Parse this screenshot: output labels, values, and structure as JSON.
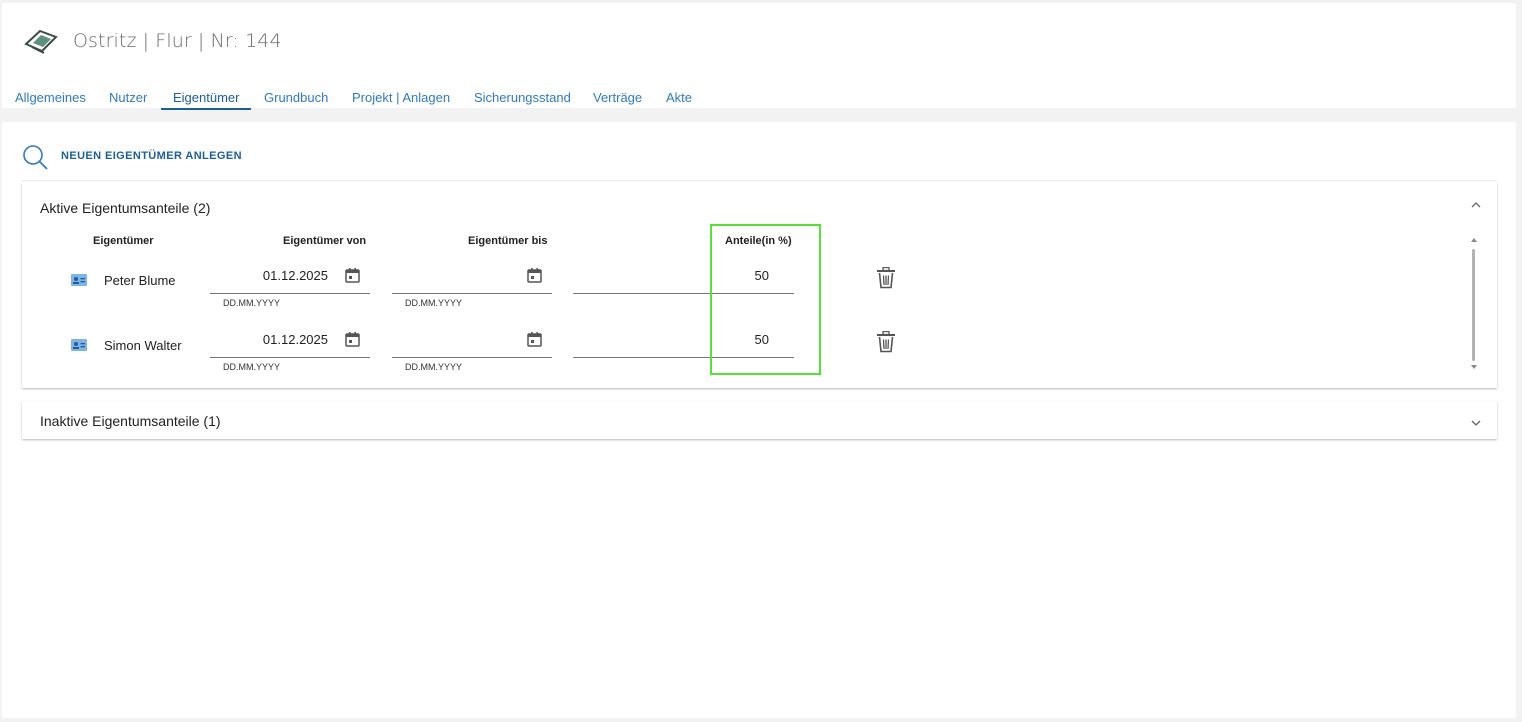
{
  "header": {
    "title": "Ostritz | Flur | Nr: 144",
    "logo_icon": "parcel-map-icon"
  },
  "tabs": [
    {
      "label": "Allgemeines"
    },
    {
      "label": "Nutzer"
    },
    {
      "label": "Eigentümer",
      "active": true
    },
    {
      "label": "Grundbuch"
    },
    {
      "label": "Projekt | Anlagen"
    },
    {
      "label": "Sicherungsstand"
    },
    {
      "label": "Verträge"
    },
    {
      "label": "Akte"
    }
  ],
  "toolbar": {
    "new_owner_label": "NEUEN EIGENTÜMER ANLEGEN",
    "search_icon": "search-icon"
  },
  "active_panel": {
    "title": "Aktive Eigentumsanteile (2)",
    "expanded": true,
    "columns": {
      "owner": "Eigentümer",
      "from": "Eigentümer von",
      "to": "Eigentümer bis",
      "share": "Anteile(in %)"
    },
    "rows": [
      {
        "name": "Peter Blume",
        "from": "01.12.2025",
        "from_hint": "DD.MM.YYYY",
        "to": "",
        "to_hint": "DD.MM.YYYY",
        "share": "50"
      },
      {
        "name": "Simon Walter",
        "from": "01.12.2025",
        "from_hint": "DD.MM.YYYY",
        "to": "",
        "to_hint": "DD.MM.YYYY",
        "share": "50"
      }
    ]
  },
  "inactive_panel": {
    "title": "Inaktive Eigentumsanteile (1)",
    "expanded": false
  },
  "colors": {
    "accent": "#1a5e9a",
    "tab_text": "#2f7ac4",
    "highlight": "#57e03a",
    "background": "#f2f2f2"
  }
}
